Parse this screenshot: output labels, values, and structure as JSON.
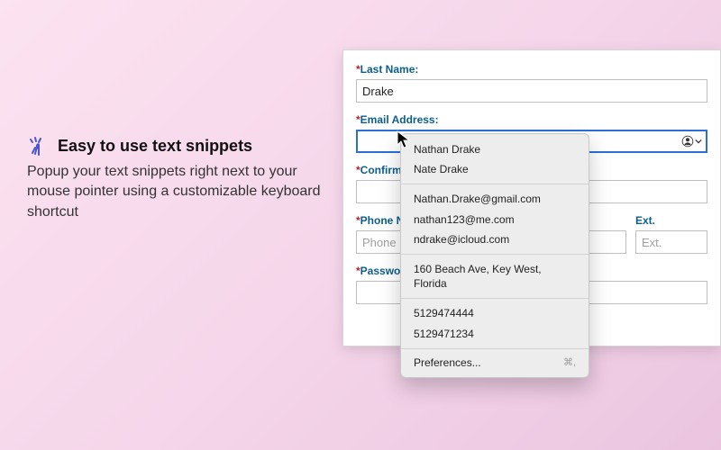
{
  "promo": {
    "title": "Easy to use text snippets",
    "description": "Popup your text snippets right next to your mouse pointer using a customizable keyboard shortcut",
    "icon_name": "snap-fingers-icon",
    "icon_color": "#4a57c8"
  },
  "form": {
    "last_name": {
      "label": "Last Name:",
      "value": "Drake"
    },
    "email": {
      "label": "Email Address:",
      "value": ""
    },
    "confirm_email": {
      "label": "Confirm Email Address:",
      "value": ""
    },
    "phone": {
      "label": "Phone Number:",
      "placeholder": "Phone",
      "value": ""
    },
    "ext": {
      "label": "Ext.",
      "placeholder": "Ext.",
      "value": ""
    },
    "password": {
      "label": "Password",
      "value": ""
    }
  },
  "popup": {
    "group1": [
      "Nathan Drake",
      "Nate Drake"
    ],
    "group2": [
      "Nathan.Drake@gmail.com",
      "nathan123@me.com",
      "ndrake@icloud.com"
    ],
    "group3": [
      "160 Beach Ave, Key West, Florida"
    ],
    "group4": [
      "5129474444",
      "5129471234"
    ],
    "preferences_label": "Preferences...",
    "preferences_shortcut": "⌘,"
  },
  "required_mark": "*"
}
